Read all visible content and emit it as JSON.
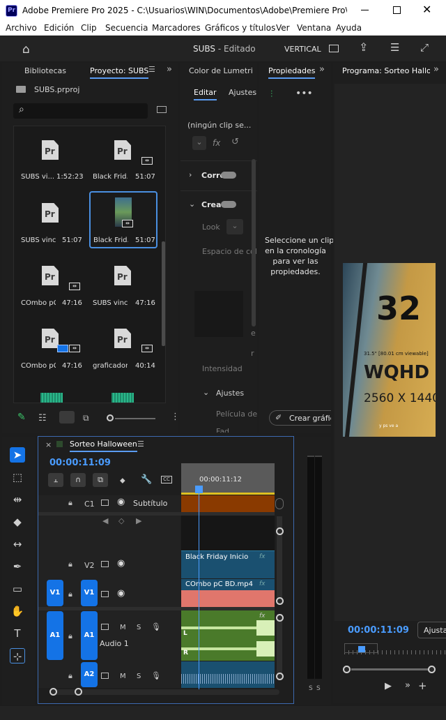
{
  "window": {
    "title": "Adobe Premiere Pro 2025 - C:\\Usuarios\\WIN\\Documentos\\Adobe\\Premiere Pro\\25.0\\S...",
    "app_icon": "Pr"
  },
  "menu": [
    "Archivo",
    "Edición",
    "Clip",
    "Secuencia",
    "Marcadores",
    "Gráficos y títulos",
    "Ver",
    "Ventana",
    "Ayuda"
  ],
  "header": {
    "project_title": "SUBS",
    "status": "- Editado",
    "vertical_label": "VERTICAL"
  },
  "project_panel": {
    "tabs": [
      "Bibliotecas",
      "Proyecto: SUBS"
    ],
    "file": "SUBS.prproj",
    "items": [
      {
        "name": "SUBS vi...",
        "duration": "1:52:23"
      },
      {
        "name": "Black Frid...",
        "duration": "51:07"
      },
      {
        "name": "SUBS vinc...",
        "duration": "51:07"
      },
      {
        "name": "Black Frid...",
        "duration": "51:07"
      },
      {
        "name": "COmbo pC...",
        "duration": "47:16"
      },
      {
        "name": "SUBS vinc...",
        "duration": "47:16"
      },
      {
        "name": "COmbo pC...",
        "duration": "47:16"
      },
      {
        "name": "graficador...",
        "duration": "40:14"
      }
    ]
  },
  "lumetri_panel": {
    "tab": "Color de Lumetri",
    "subtabs": [
      "Editar",
      "Ajustes"
    ],
    "no_clip": "(ningún clip se...",
    "fx": "fx",
    "sections": [
      "Corre",
      "Creati"
    ],
    "look_label": "Look",
    "color_space": "Espacio de col",
    "e1": "e",
    "r1": "r",
    "intensity": "Intensidad",
    "ajustes": "Ajustes",
    "pelicula": "Película de",
    "fade": "Fad"
  },
  "properties_panel": {
    "tab": "Propiedades",
    "message": [
      "Seleccione un clip",
      "en la cronología",
      "para ver las",
      "propiedades."
    ],
    "create_graphic": "Crear gráfico"
  },
  "program_panel": {
    "tab": "Programa: Sorteo Hallowe",
    "timecode": "00:00:11:09",
    "fit": "Ajusta",
    "video_text": {
      "number": "32",
      "spec": "31.5\" [80.01 cm viewable]",
      "brand": "WQHD",
      "res": "2560 X 1440",
      "caption": "y ps ve a"
    }
  },
  "timeline": {
    "sequence": "Sorteo Halloween",
    "timecode": "00:00:11:09",
    "ruler_time": "00:00:11:12",
    "tracks": {
      "c1": {
        "label": "C1",
        "name": "Subtítulo"
      },
      "v2": {
        "label": "V2",
        "clip": "Black Friday Inicio ..."
      },
      "v1": {
        "label": "V1",
        "src": "V1",
        "clip": "COmbo pC BD.mp4"
      },
      "a1": {
        "label": "A1",
        "src": "A1",
        "name": "Audio 1"
      },
      "a2": {
        "label": "A2"
      }
    },
    "m": "M",
    "s": "S",
    "l": "L",
    "r": "R",
    "fx": "fx"
  },
  "meter": {
    "labels": [
      "S",
      "S"
    ]
  },
  "colors": {
    "accent": "#1473e6",
    "timecode": "#4a9cff",
    "subtitle_clip": "#8a3a00",
    "video_clip": "#e0766c",
    "video_clip_header": "#1a5070",
    "audio_clip": "#4a7a2a"
  }
}
